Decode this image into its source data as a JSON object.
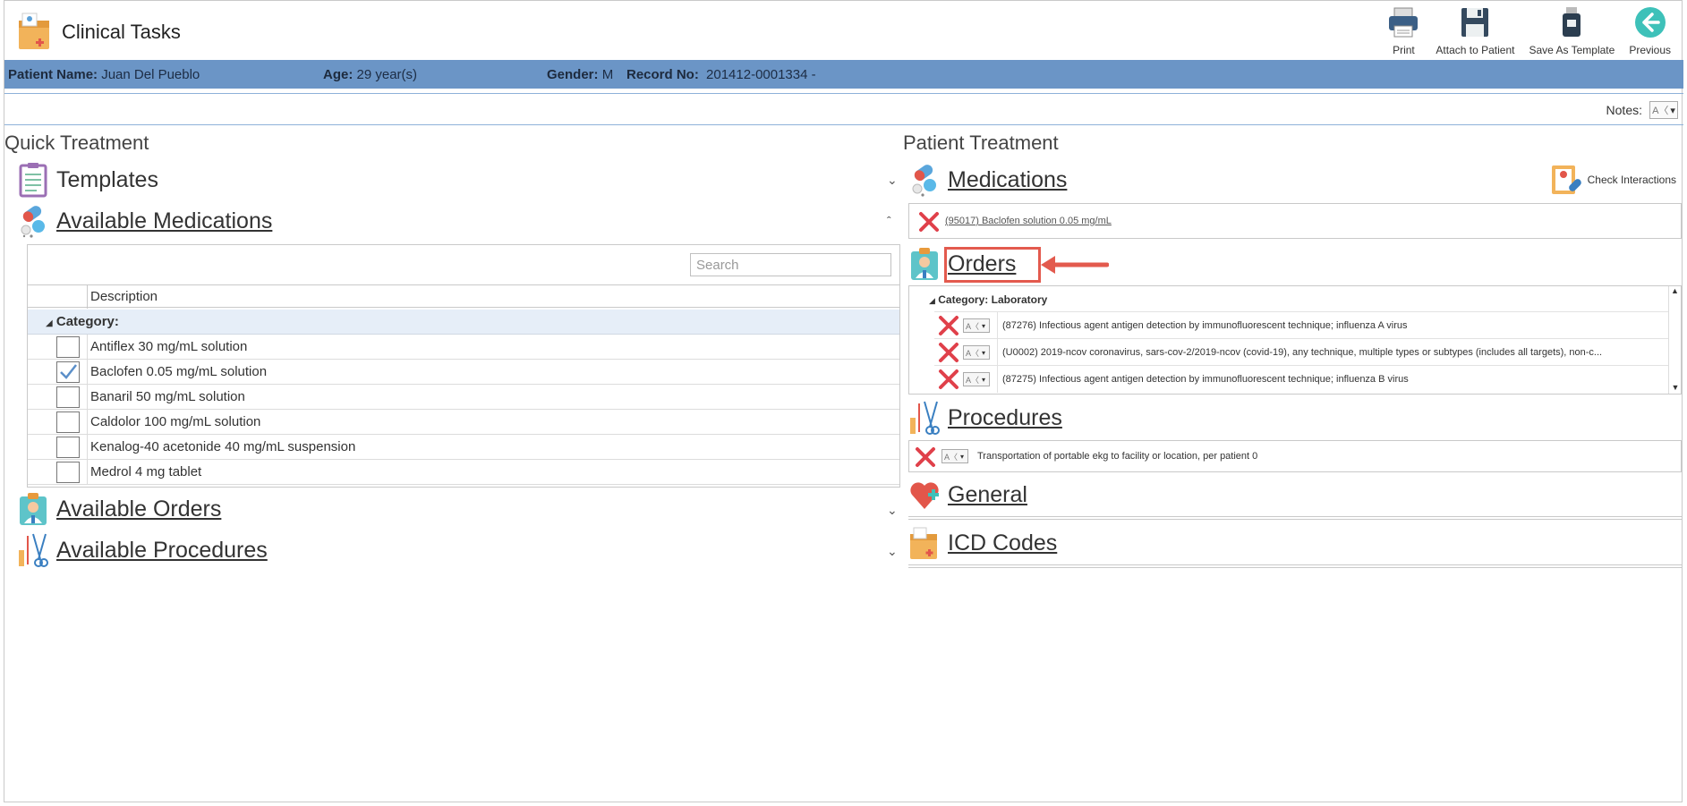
{
  "app": {
    "title": "Clinical Tasks"
  },
  "toolbar": {
    "print": "Print",
    "attach": "Attach to Patient",
    "save_template": "Save As Template",
    "previous": "Previous"
  },
  "patient": {
    "name_label": "Patient Name:",
    "name": "Juan Del Pueblo",
    "age_label": "Age:",
    "age": "29 year(s)",
    "gender_label": "Gender:",
    "gender": "M",
    "record_label": "Record No:",
    "record": "201412-0001334 -"
  },
  "notes": {
    "label": "Notes:"
  },
  "quick": {
    "title": "Quick Treatment",
    "templates": "Templates",
    "available_medications": "Available Medications",
    "available_orders": "Available Orders",
    "available_procedures": "Available Procedures",
    "search_placeholder": "Search",
    "col_description": "Description",
    "group_label": "Category:",
    "medications": [
      {
        "name": "Antiflex 30 mg/mL solution",
        "checked": false
      },
      {
        "name": "Baclofen 0.05 mg/mL solution",
        "checked": true
      },
      {
        "name": "Banaril 50 mg/mL solution",
        "checked": false
      },
      {
        "name": "Caldolor 100 mg/mL solution",
        "checked": false
      },
      {
        "name": "Kenalog-40 acetonide 40 mg/mL suspension",
        "checked": false
      },
      {
        "name": "Medrol 4 mg tablet",
        "checked": false
      }
    ]
  },
  "patient_treatment": {
    "title": "Patient Treatment",
    "medications": "Medications",
    "check_interactions": "Check Interactions",
    "med_item": "(95017) Baclofen solution 0.05 mg/mL",
    "orders": "Orders",
    "orders_category": "Category: Laboratory",
    "order_items": [
      "(87276) Infectious agent antigen detection by immunofluorescent technique; influenza A virus",
      "(U0002) 2019-ncov coronavirus, sars-cov-2/2019-ncov (covid-19), any technique, multiple types or subtypes (includes all targets), non-c...",
      "(87275) Infectious agent antigen detection by immunofluorescent technique; influenza B virus"
    ],
    "procedures": "Procedures",
    "procedure_item": "Transportation of portable ekg to facility or location, per patient 0",
    "general": "General",
    "icd_codes": "ICD Codes"
  },
  "colors": {
    "patient_bar": "#6b95c6",
    "highlight": "#e35a4e",
    "delete": "#e0404a"
  }
}
